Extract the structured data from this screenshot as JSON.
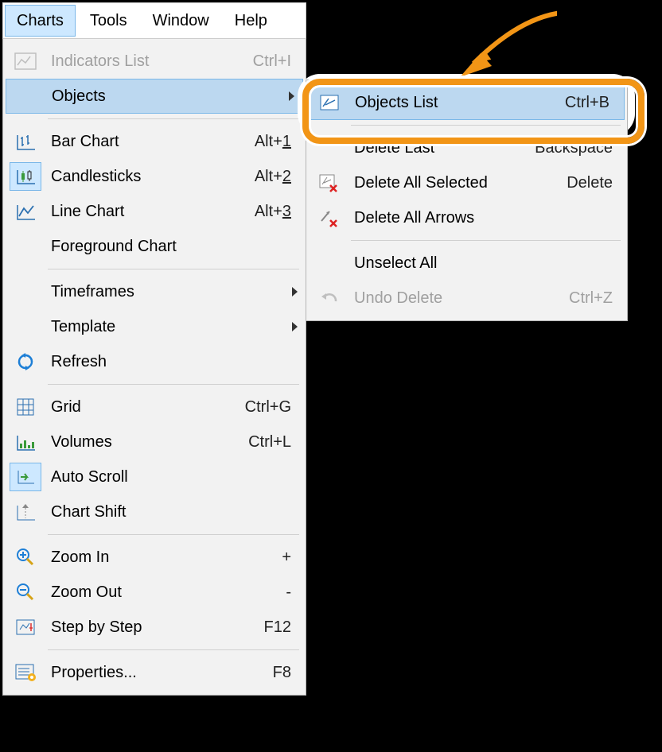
{
  "menubar": {
    "charts": "Charts",
    "tools": "Tools",
    "window": "Window",
    "help": "Help"
  },
  "menu": {
    "indicators": {
      "label": "Indicators List",
      "accel": "Ctrl+I"
    },
    "objects": {
      "label": "Objects"
    },
    "bar": {
      "label": "Bar Chart",
      "accel": "Alt+",
      "accel_u": "1"
    },
    "candle": {
      "label": "Candlesticks",
      "accel": "Alt+",
      "accel_u": "2"
    },
    "line": {
      "label": "Line Chart",
      "accel": "Alt+",
      "accel_u": "3"
    },
    "fg": {
      "label": "Foreground Chart"
    },
    "tf": {
      "label": "Timeframes"
    },
    "tpl": {
      "label": "Template"
    },
    "refresh": {
      "label": "Refresh"
    },
    "grid": {
      "label": "Grid",
      "accel": "Ctrl+G"
    },
    "vol": {
      "label": "Volumes",
      "accel": "Ctrl+L"
    },
    "autoscroll": {
      "label": "Auto Scroll"
    },
    "shift": {
      "label": "Chart Shift"
    },
    "zin": {
      "label": "Zoom In",
      "accel": "+"
    },
    "zout": {
      "label": "Zoom Out",
      "accel": "-"
    },
    "step": {
      "label": "Step by Step",
      "accel": "F12"
    },
    "props": {
      "label": "Properties...",
      "accel": "F8"
    }
  },
  "sub": {
    "objlist": {
      "label": "Objects List",
      "accel": "Ctrl+B"
    },
    "dellast": {
      "label": "Delete Last",
      "accel": "Backspace"
    },
    "delsel": {
      "label": "Delete All Selected",
      "accel": "Delete"
    },
    "delarr": {
      "label": "Delete All Arrows"
    },
    "unsel": {
      "label": "Unselect All"
    },
    "undo": {
      "label": "Undo Delete",
      "accel": "Ctrl+Z"
    }
  }
}
